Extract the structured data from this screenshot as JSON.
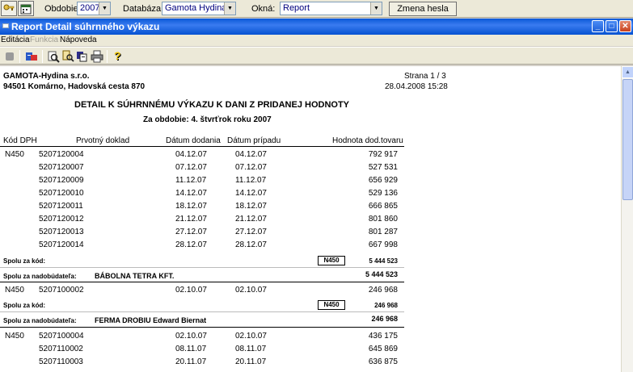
{
  "toolbar": {
    "period_label": "Obdobie:",
    "period_value": "2007",
    "database_label": "Databáza:",
    "database_value": "Gamota Hydina",
    "windows_label": "Okná:",
    "windows_value": "Report",
    "change_password_label": "Zmena hesla"
  },
  "window": {
    "title": "Report Detail súhrnného výkazu"
  },
  "menu": {
    "items": [
      {
        "label": "Editácia",
        "enabled": true
      },
      {
        "label": "Funkcia",
        "enabled": false
      },
      {
        "label": "Nápoveda",
        "enabled": true
      }
    ]
  },
  "report": {
    "company_name": "GAMOTA-Hydina s.r.o.",
    "company_address": "94501 Komárno, Hadovská cesta  870",
    "page": "Strana 1 / 3",
    "datetime": "28.04.2008 15:28",
    "title": "DETAIL K SÚHRNNÉMU VÝKAZU K DANI Z PRIDANEJ HODNOTY",
    "period": "Za obdobie: 4. štvrťrok roku 2007",
    "columns": {
      "vat_code": "Kód DPH",
      "primary_doc": "Prvotný doklad",
      "delivery_date": "Dátum dodania",
      "case_date": "Dátum prípadu",
      "value": "Hodnota dod.tovaru"
    },
    "group1": {
      "rows": [
        {
          "code": "N450",
          "doc": "5207120004",
          "delivery": "04.12.07",
          "case": "04.12.07",
          "value": "792 917"
        },
        {
          "code": "",
          "doc": "5207120007",
          "delivery": "07.12.07",
          "case": "07.12.07",
          "value": "527 531"
        },
        {
          "code": "",
          "doc": "5207120009",
          "delivery": "11.12.07",
          "case": "11.12.07",
          "value": "656 929"
        },
        {
          "code": "",
          "doc": "5207120010",
          "delivery": "14.12.07",
          "case": "14.12.07",
          "value": "529 136"
        },
        {
          "code": "",
          "doc": "5207120011",
          "delivery": "18.12.07",
          "case": "18.12.07",
          "value": "666 865"
        },
        {
          "code": "",
          "doc": "5207120012",
          "delivery": "21.12.07",
          "case": "21.12.07",
          "value": "801 860"
        },
        {
          "code": "",
          "doc": "5207120013",
          "delivery": "27.12.07",
          "case": "27.12.07",
          "value": "801 287"
        },
        {
          "code": "",
          "doc": "5207120014",
          "delivery": "28.12.07",
          "case": "28.12.07",
          "value": "667 998"
        }
      ],
      "subtotal_label": "Spolu za kód:",
      "subtotal_code": "N450",
      "subtotal_value": "5 444 523",
      "acquirer_label": "Spolu za nadobúdateľa:",
      "acquirer_name": "BÁBOLNA TETRA KFT.",
      "acquirer_total": "5 444 523"
    },
    "group2": {
      "rows": [
        {
          "code": "N450",
          "doc": "5207100002",
          "delivery": "02.10.07",
          "case": "02.10.07",
          "value": "246 968"
        }
      ],
      "subtotal_label": "Spolu za kód:",
      "subtotal_code": "N450",
      "subtotal_value": "246 968",
      "acquirer_label": "Spolu za nadobúdateľa:",
      "acquirer_name": "FERMA DROBIU  Edward Biernat",
      "acquirer_total": "246 968"
    },
    "group3": {
      "rows": [
        {
          "code": "N450",
          "doc": "5207100004",
          "delivery": "02.10.07",
          "case": "02.10.07",
          "value": "436 175"
        },
        {
          "code": "",
          "doc": "5207110002",
          "delivery": "08.11.07",
          "case": "08.11.07",
          "value": "645 869"
        },
        {
          "code": "",
          "doc": "5207110003",
          "delivery": "20.11.07",
          "case": "20.11.07",
          "value": "636 875"
        }
      ]
    }
  },
  "icons": {
    "top": [
      "key-icon",
      "calendar-icon"
    ],
    "toolbar": [
      "stop-icon",
      "export-icon",
      "zoom-icon",
      "search-icon",
      "pages-icon",
      "print-icon",
      "help-icon"
    ]
  }
}
